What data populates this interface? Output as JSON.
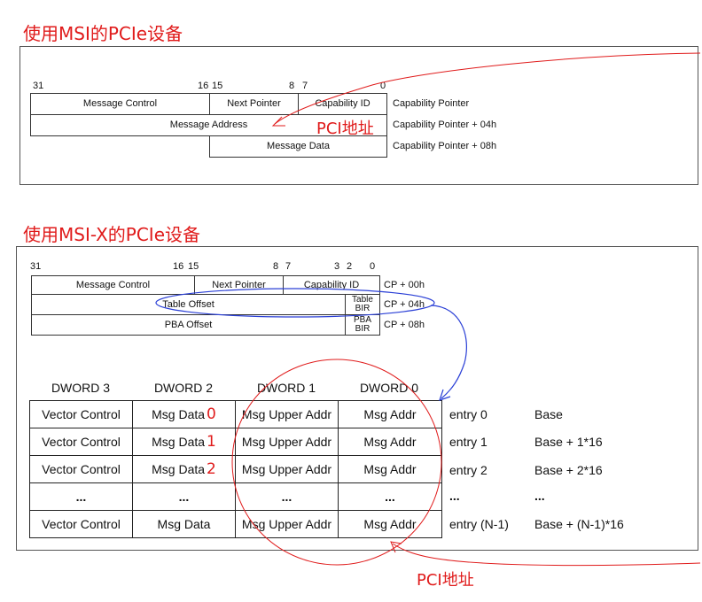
{
  "msi": {
    "heading": "使用MSI的PCIe设备",
    "bits": [
      "31",
      "16",
      "15",
      "8",
      "7",
      "0"
    ],
    "rows": [
      [
        "Message Control",
        "Next Pointer",
        "Capability ID"
      ],
      [
        "Message Address"
      ],
      [
        "Message Data"
      ]
    ],
    "row_labels": [
      "Capability Pointer",
      "Capability Pointer + 04h",
      "Capability Pointer + 08h"
    ],
    "annotation": "PCI地址"
  },
  "msix": {
    "heading": "使用MSI-X的PCIe设备",
    "bits": [
      "31",
      "16",
      "15",
      "8",
      "7",
      "3",
      "2",
      "0"
    ],
    "rows": {
      "row0": [
        "Message Control",
        "Next Pointer",
        "Capability ID"
      ],
      "table_offset": "Table Offset",
      "table_bir": [
        "Table",
        "BIR"
      ],
      "pba_offset": "PBA Offset",
      "pba_bir": [
        "PBA",
        "BIR"
      ]
    },
    "row_labels": [
      "CP + 00h",
      "CP + 04h",
      "CP + 08h"
    ],
    "table": {
      "headers": [
        "DWORD 3",
        "DWORD 2",
        "DWORD 1",
        "DWORD 0"
      ],
      "rows": [
        {
          "cells": [
            "Vector Control",
            "Msg Data",
            "Msg Upper Addr",
            "Msg Addr"
          ],
          "index": "0",
          "entry": "entry 0",
          "addr": "Base"
        },
        {
          "cells": [
            "Vector Control",
            "Msg Data",
            "Msg Upper Addr",
            "Msg Addr"
          ],
          "index": "1",
          "entry": "entry 1",
          "addr": "Base + 1*16"
        },
        {
          "cells": [
            "Vector Control",
            "Msg Data",
            "Msg Upper Addr",
            "Msg Addr"
          ],
          "index": "2",
          "entry": "entry 2",
          "addr": "Base + 2*16"
        },
        {
          "cells": [
            "...",
            "...",
            "...",
            "..."
          ],
          "index": "",
          "entry": "...",
          "addr": "..."
        },
        {
          "cells": [
            "Vector Control",
            "Msg Data",
            "Msg Upper Addr",
            "Msg Addr"
          ],
          "index": "",
          "entry": "entry (N-1)",
          "addr": "Base + (N-1)*16"
        }
      ]
    },
    "annotation": "PCI地址"
  },
  "colors": {
    "annotation": "#e01b1b",
    "ellipse_blue": "#2a3fd6"
  }
}
